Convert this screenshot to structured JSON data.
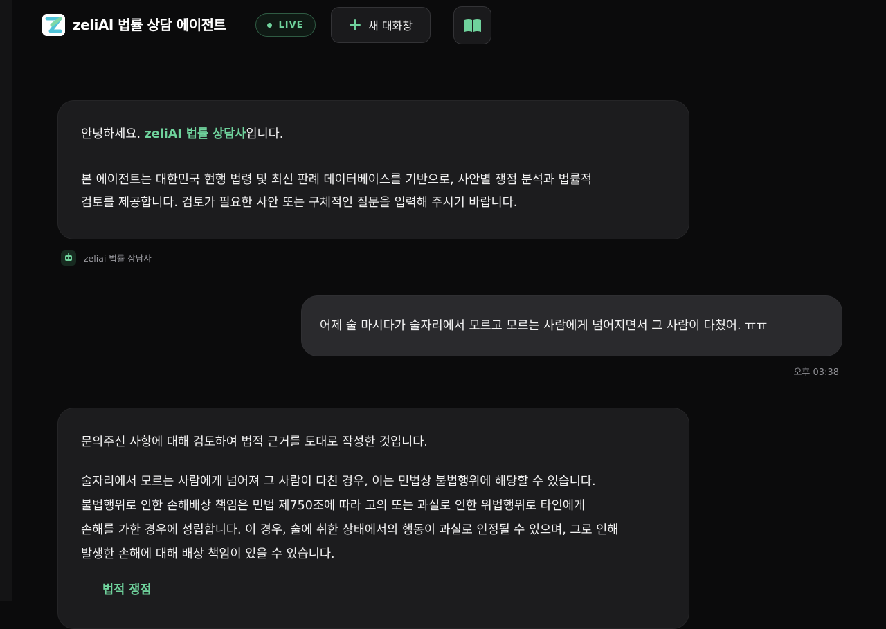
{
  "header": {
    "title": "zeliAI 법률 상담 에이전트",
    "live_label": "LIVE",
    "new_chat_label": "새 대화창",
    "logo_icon": "zeliai-logo-icon",
    "book_icon": "open-book-icon"
  },
  "messages": {
    "bot_intro": {
      "greeting_prefix": "안녕하세요.",
      "greeting_highlight": "zeliAI 법률 상담사",
      "greeting_suffix": "입니다.",
      "line2": "본 에이전트는 대한민국 현행 법령 및 최신 판례 데이터베이스를 기반으로, 사안별 쟁점 분석과 법률적",
      "line3": "검토를 제공합니다. 검토가 필요한 사안 또는 구체적인 질문을 입력해 주시기 바랍니다.",
      "sender_name": "zeliai 법률 상담사",
      "sender_icon": "robot-icon"
    },
    "user_msg": {
      "text": "어제 술 마시다가 술자리에서 모르고 모르는 사람에게 넘어지면서 그 사람이 다쳤어. ㅠㅠ",
      "time": "오후 03:38"
    },
    "bot_reply": {
      "line1": "문의주신 사항에 대해 검토하여 법적 근거를 토대로 작성한 것입니다.",
      "para_lines": [
        "술자리에서 모르는 사람에게 넘어져 그 사람이 다친 경우, 이는 민법상 불법행위에 해당할 수 있습니다.",
        "불법행위로 인한 손해배상 책임은 민법 제750조에 따라 고의 또는 과실로 인한 위법행위로 타인에게",
        "손해를 가한 경우에 성립합니다. 이 경우, 술에 취한 상태에서의 행동이 과실로 인정될 수 있으며, 그로 인해",
        "발생한 손해에 대해 배상 책임이 있을 수 있습니다."
      ],
      "section_heading": "법적 쟁점"
    }
  },
  "colors": {
    "accent": "#6fd29c",
    "background": "#0b0b0c",
    "bubble_bot": "#1c1c1e",
    "bubble_user": "#2a2a2d"
  }
}
